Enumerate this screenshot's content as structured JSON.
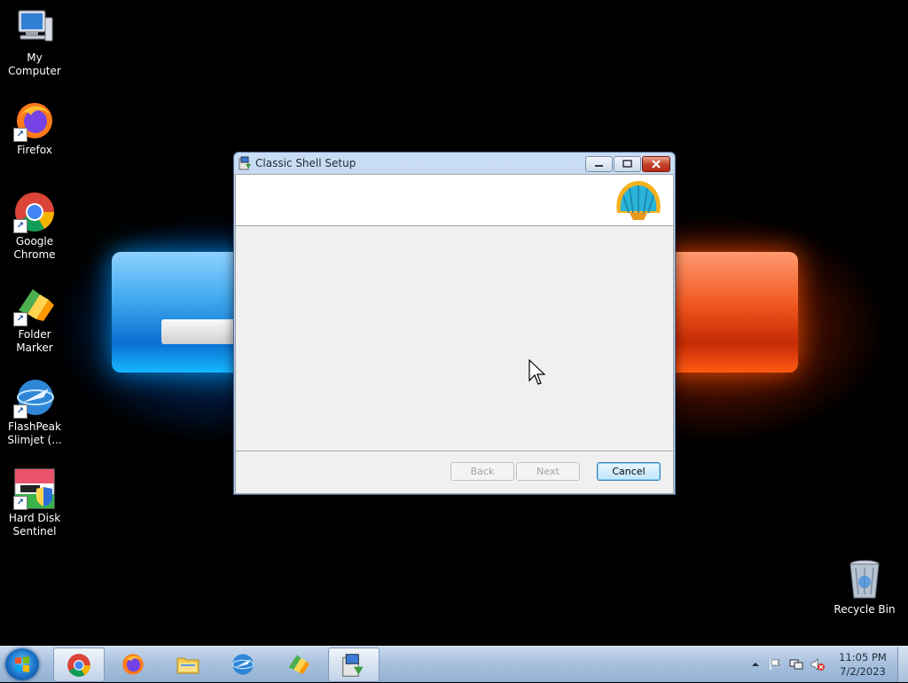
{
  "desktop": {
    "icons": [
      {
        "label": "My Computer",
        "icon": "computer-icon"
      },
      {
        "label": "Firefox",
        "icon": "firefox-icon"
      },
      {
        "label": "Google Chrome",
        "icon": "chrome-icon"
      },
      {
        "label": "Folder Marker",
        "icon": "folder-marker-icon"
      },
      {
        "label": "FlashPeak Slimjet (...",
        "icon": "slimjet-icon"
      },
      {
        "label": "Hard Disk Sentinel",
        "icon": "hdsentinel-icon"
      }
    ],
    "recycle_bin": {
      "label": "Recycle Bin",
      "icon": "recycle-bin-icon"
    }
  },
  "window": {
    "title": "Classic Shell Setup",
    "icon": "installer-icon",
    "logo": "classic-shell-logo",
    "buttons": {
      "back": "Back",
      "next": "Next",
      "cancel": "Cancel"
    }
  },
  "taskbar": {
    "apps": [
      {
        "name": "Google Chrome",
        "icon": "chrome-icon"
      },
      {
        "name": "Firefox",
        "icon": "firefox-icon"
      },
      {
        "name": "File Explorer",
        "icon": "explorer-icon"
      },
      {
        "name": "FlashPeak Slimjet",
        "icon": "slimjet-icon"
      },
      {
        "name": "Folder Marker",
        "icon": "folder-marker-icon"
      },
      {
        "name": "Classic Shell Setup",
        "icon": "installer-icon"
      }
    ],
    "clock": {
      "time": "11:05 PM",
      "date": "7/2/2023"
    }
  },
  "colors": {
    "taskbar": "#a9c1de",
    "dialog_bg": "#f0f0f0",
    "cancel_border": "#3c7fb1"
  }
}
